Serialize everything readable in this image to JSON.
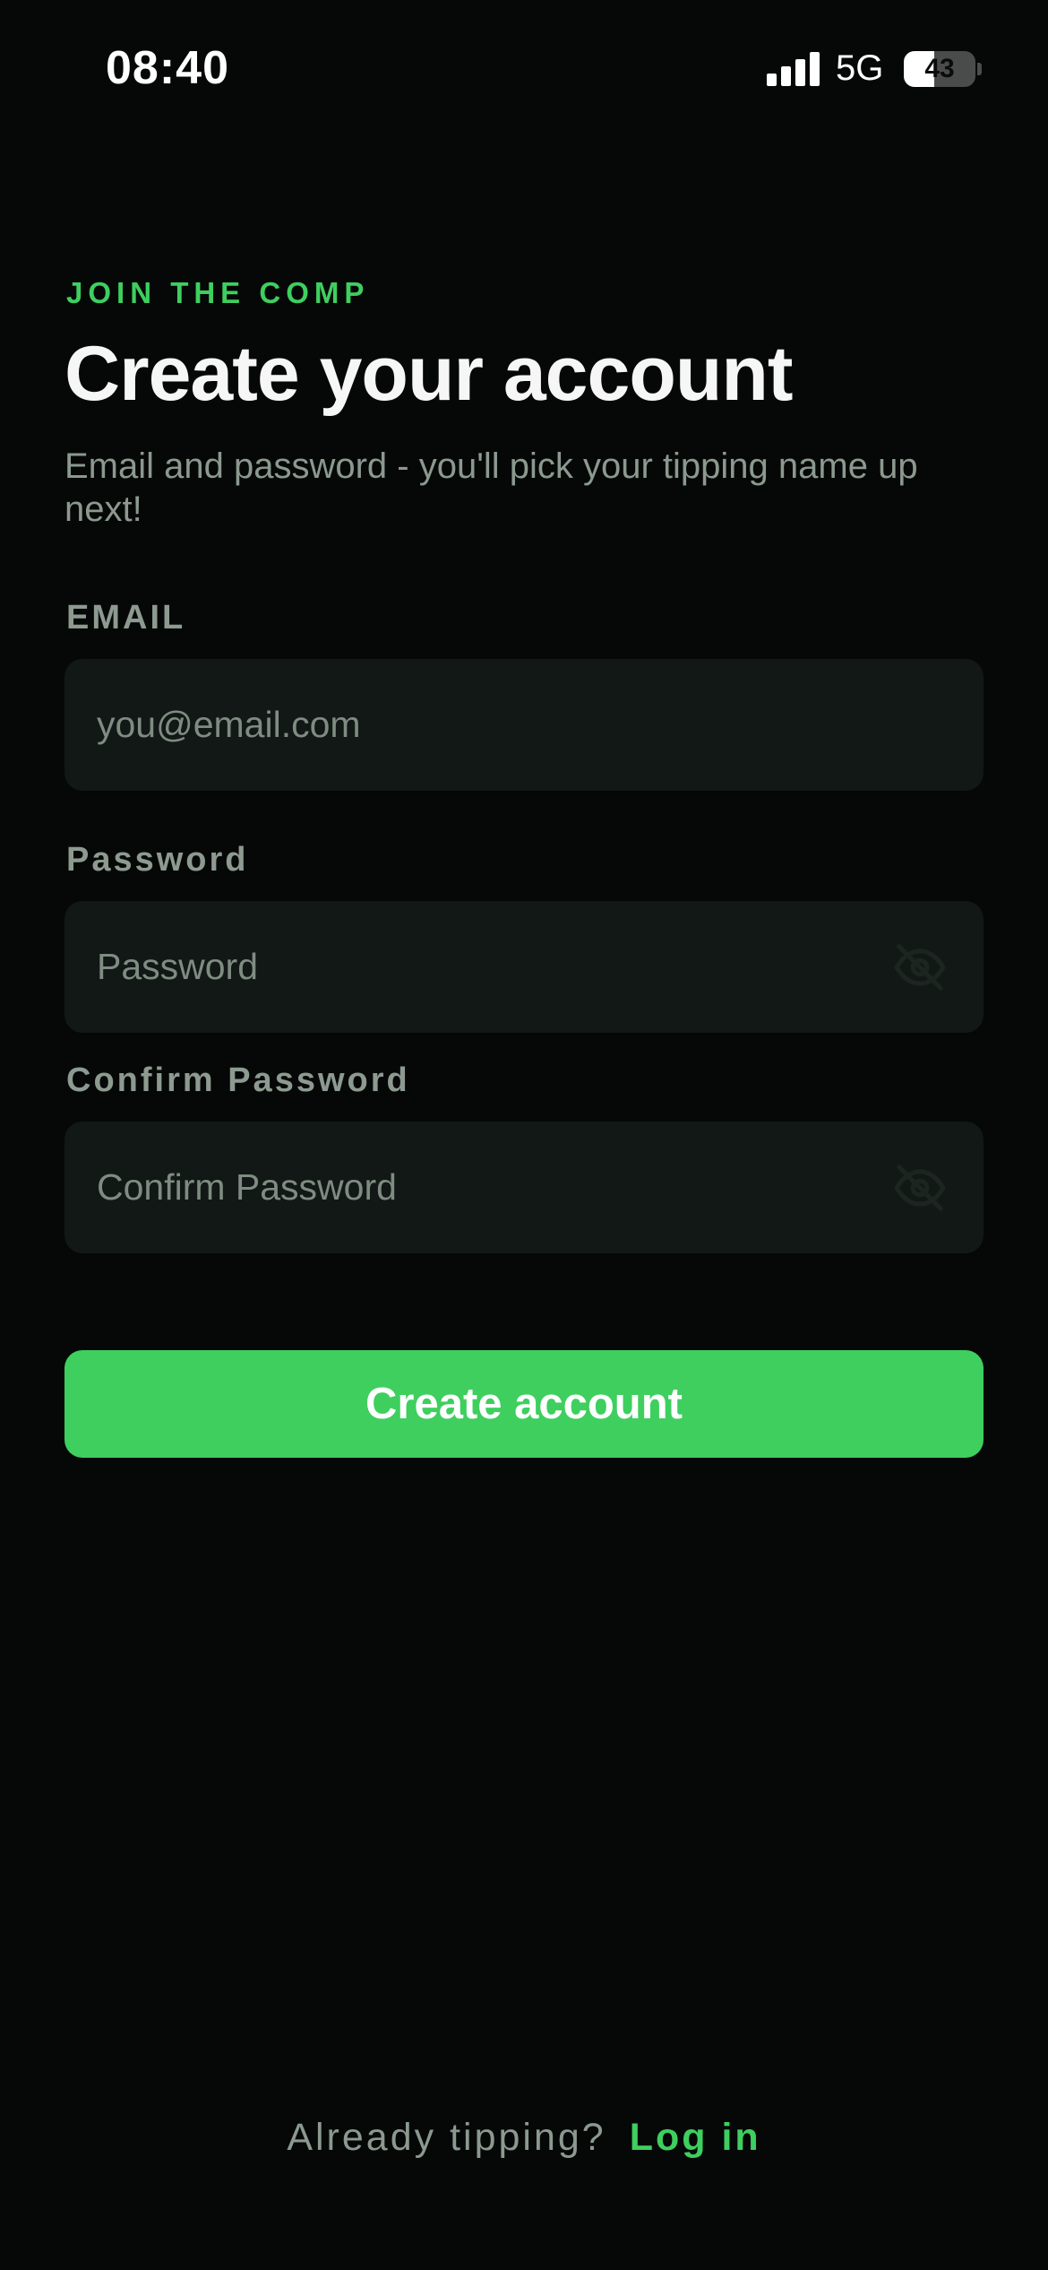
{
  "status_bar": {
    "time": "08:40",
    "network": "5G",
    "battery_percent": "43",
    "battery_level": 0.43
  },
  "header": {
    "eyebrow": "JOIN THE COMP",
    "title": "Create your account",
    "subtitle": "Email and password -  you'll pick your tipping name up next!"
  },
  "form": {
    "email": {
      "label": "EMAIL",
      "placeholder": "you@email.com",
      "value": ""
    },
    "password": {
      "label": "Password",
      "placeholder": "Password",
      "value": "",
      "toggle_icon": "eye-off-icon"
    },
    "confirm_password": {
      "label": "Confirm Password",
      "placeholder": "Confirm Password",
      "value": "",
      "toggle_icon": "eye-off-icon"
    },
    "submit_label": "Create account"
  },
  "footer": {
    "prompt": "Already tipping?",
    "link_label": "Log in"
  },
  "colors": {
    "background": "#060807",
    "accent": "#3ecf5f",
    "input_background": "#111815",
    "muted_text": "#8b998f"
  }
}
